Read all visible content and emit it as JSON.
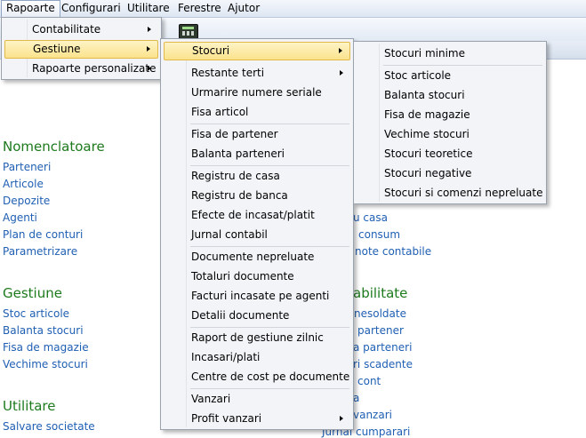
{
  "menubar": {
    "items": [
      "Rapoarte",
      "Configurari",
      "Utilitare",
      "Ferestre",
      "Ajutor"
    ]
  },
  "menu_rapoarte": {
    "items": [
      "Contabilitate",
      "Gestiune",
      "Rapoarte personalizate"
    ]
  },
  "menu_gestiune": {
    "items": [
      "Stocuri",
      "Restante terti",
      "Urmarire numere seriale",
      "Fisa articol",
      "Fisa de partener",
      "Balanta parteneri",
      "Registru de casa",
      "Registru de banca",
      "Efecte de incasat/platit",
      "Jurnal contabil",
      "Documente nepreluate",
      "Totaluri documente",
      "Facturi incasate pe agenti",
      "Detalii documente",
      "Raport de gestiune zilnic",
      "Incasari/plati",
      "Centre de cost pe documente",
      "Vanzari",
      "Profit vanzari"
    ]
  },
  "menu_stocuri": {
    "items": [
      "Stocuri minime",
      "Stoc articole",
      "Balanta stocuri",
      "Fisa de magazie",
      "Vechime stocuri",
      "Stocuri teoretice",
      "Stocuri negative",
      "Stocuri si comenzi nepreluate"
    ]
  },
  "nomenclatoare": {
    "title": "Nomenclatoare",
    "links": [
      "Parteneri",
      "Articole",
      "Depozite",
      "Agenti",
      "Plan de conturi",
      "Parametrizare"
    ]
  },
  "gestiune_section": {
    "title": "Gestiune",
    "links": [
      "Stoc articole",
      "Balanta stocuri",
      "Fisa de magazie",
      "Vechime stocuri"
    ]
  },
  "utilitare_section": {
    "title": "Utilitare",
    "links": [
      "Salvare societate"
    ]
  },
  "right_column": {
    "title_fragment": "abilitate",
    "links": [
      "u casa",
      "consum",
      "note contabile",
      "nesoldate",
      "partener",
      "a parteneri",
      "ri scadente",
      "cont",
      "a",
      "vanzari",
      "Jurnal cumparari"
    ]
  }
}
